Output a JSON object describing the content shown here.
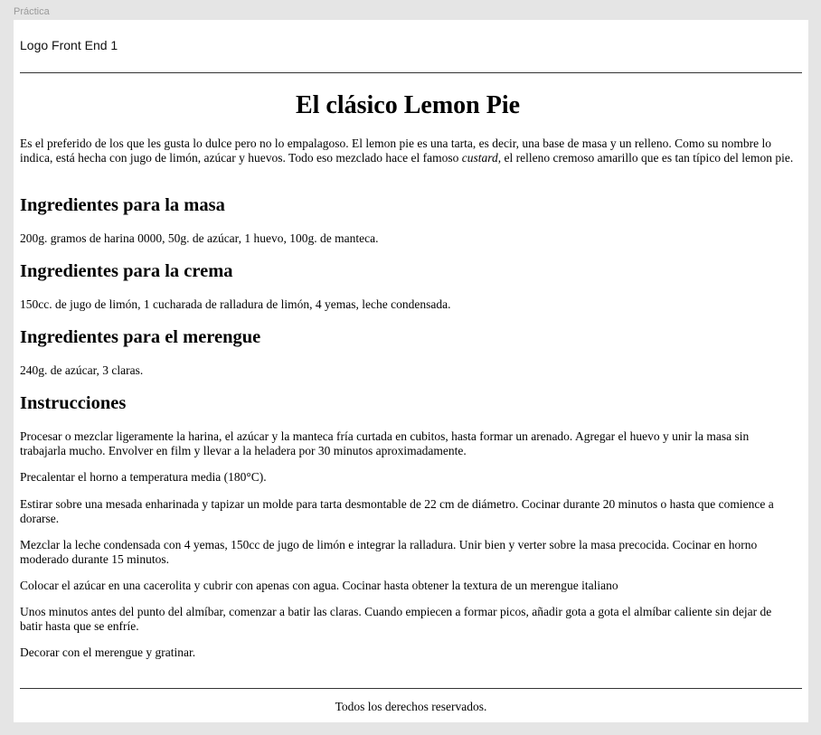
{
  "frame": {
    "label": "Práctica"
  },
  "header": {
    "logo": "Logo Front End 1"
  },
  "article": {
    "title": "El clásico Lemon Pie",
    "intro": {
      "before": "Es el preferido de los que les gusta lo dulce pero no lo empalagoso. El lemon pie es una tarta, es decir, una base de masa y un relleno. Como su nombre lo indica, está hecha con jugo de limón, azúcar y huevos. Todo eso mezclado hace el famoso ",
      "emphasis": "custard",
      "after": ", el relleno cremoso amarillo que es tan típico del lemon pie."
    },
    "sections": [
      {
        "heading": "Ingredientes para la masa",
        "text": "200g. gramos de harina 0000, 50g. de azúcar, 1 huevo, 100g. de manteca."
      },
      {
        "heading": "Ingredientes para la crema",
        "text": "150cc. de jugo de limón, 1 cucharada de ralladura de limón, 4 yemas, leche condensada."
      },
      {
        "heading": "Ingredientes para el merengue",
        "text": "240g. de azúcar, 3 claras."
      }
    ],
    "instructions": {
      "heading": "Instrucciones",
      "steps": [
        "Procesar o mezclar ligeramente la harina, el azúcar y la manteca fría curtada en cubitos, hasta formar un arenado. Agregar el huevo y unir la masa sin trabajarla mucho. Envolver en film y llevar a la heladera por 30 minutos aproximadamente.",
        "Precalentar el horno a temperatura media (180°C).",
        "Estirar sobre una mesada enharinada y tapizar un molde para tarta desmontable de 22 cm de diámetro. Cocinar durante 20 minutos o hasta que comience a dorarse.",
        "Mezclar la leche condensada con 4 yemas, 150cc de jugo de limón e integrar la ralladura. Unir bien y verter sobre la masa precocida. Cocinar en horno moderado durante 15 minutos.",
        "Colocar el azúcar en una cacerolita y cubrir con apenas con agua. Cocinar hasta obtener la textura de un merengue italiano",
        "Unos minutos antes del punto del almíbar, comenzar a batir las claras. Cuando empiecen a formar picos, añadir gota a gota el almíbar caliente sin dejar de batir hasta que se enfríe.",
        "Decorar con el merengue y gratinar."
      ]
    }
  },
  "footer": {
    "text": "Todos los derechos reservados."
  }
}
